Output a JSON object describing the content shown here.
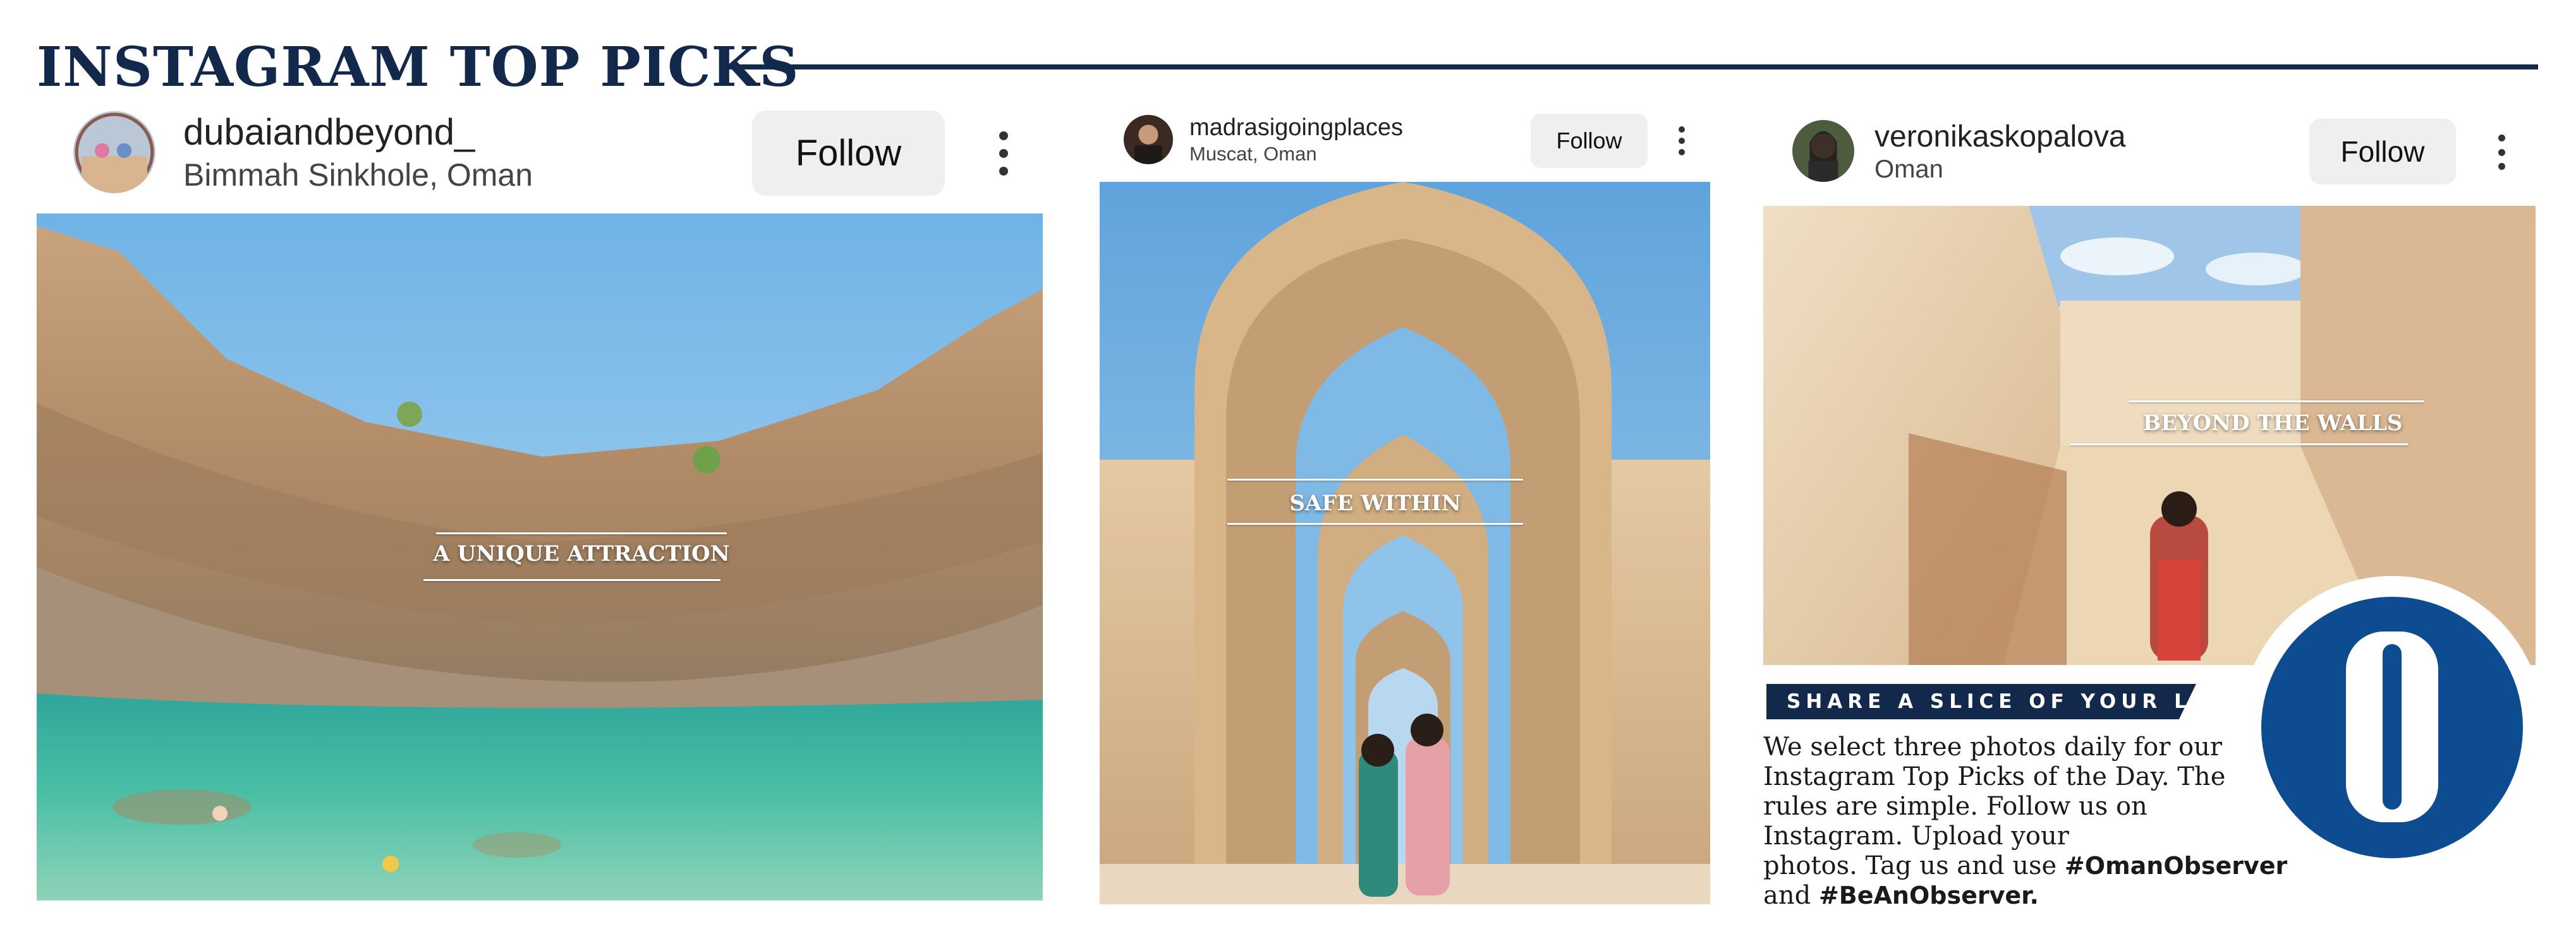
{
  "page": {
    "title": "INSTAGRAM TOP PICKS"
  },
  "posts": [
    {
      "username": "dubaiandbeyond_",
      "location": "Bimmah Sinkhole, Oman",
      "follow_label": "Follow",
      "caption": "A UNIQUE ATTRACTION"
    },
    {
      "username": "madrasigoingplaces",
      "location": "Muscat, Oman",
      "follow_label": "Follow",
      "caption": "SAFE WITHIN"
    },
    {
      "username": "veronikaskopalova",
      "location": "Oman",
      "follow_label": "Follow",
      "caption": "BEYOND THE WALLS"
    }
  ],
  "promo": {
    "banner": "SHARE A SLICE OF YOUR LIFE",
    "body_lines": [
      "We select three photos daily for our",
      "Instagram Top Picks of the Day. The",
      "rules are simple. Follow us on",
      "Instagram. Upload your",
      "photos. Tag us and use "
    ],
    "hashtag_1": "#OmanObserver",
    "and_word": "and ",
    "hashtag_2": "#BeAnObserver."
  },
  "colors": {
    "brand_navy": "#13294b",
    "logo_blue": "#0e4c92"
  },
  "icons": [
    "more-options-icon",
    "observer-logo"
  ]
}
